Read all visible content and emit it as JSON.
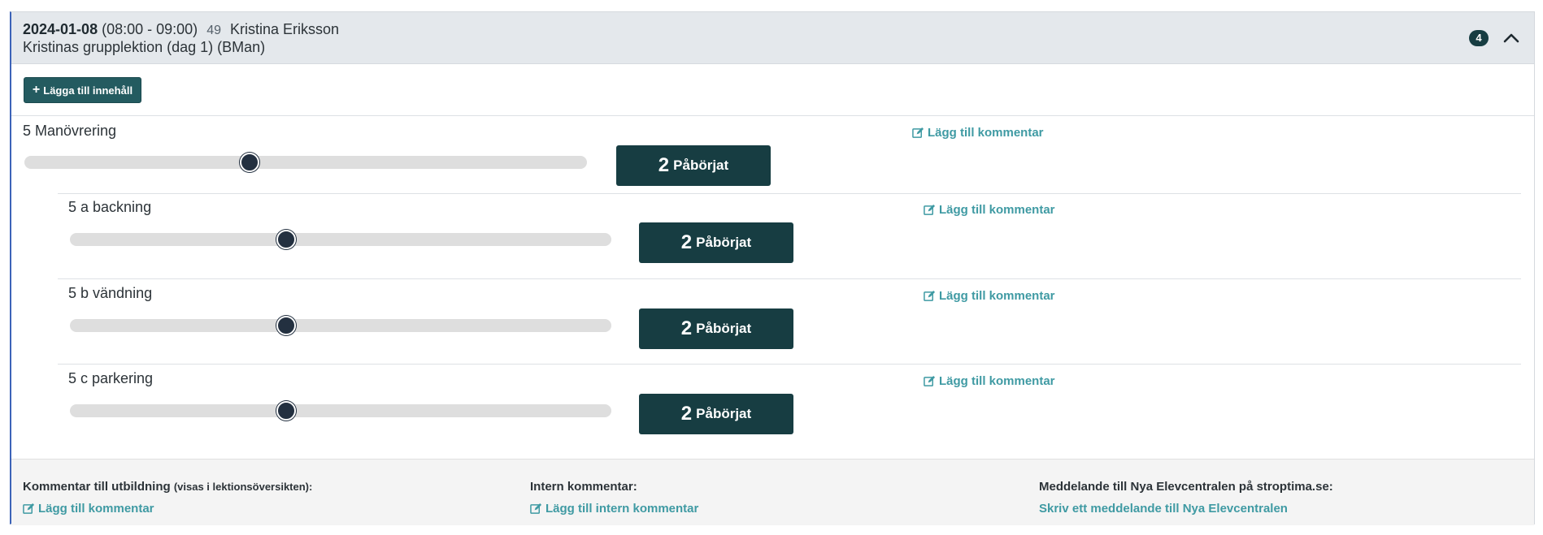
{
  "header": {
    "date": "2024-01-08",
    "time": "(08:00 - 09:00)",
    "number": "49",
    "student": "Kristina Eriksson",
    "lesson": "Kristinas grupplektion (dag 1) (BMan)",
    "badge_count": "4"
  },
  "toolbar": {
    "add_content_label": "Lägga till innehåll"
  },
  "items": [
    {
      "label": "5 Manövrering",
      "level": "2",
      "status": "Påbörjat",
      "progress": 0.4,
      "comment_label": "Lägg till kommentar"
    },
    {
      "label": "5 a backning",
      "level": "2",
      "status": "Påbörjat",
      "progress": 0.4,
      "comment_label": "Lägg till kommentar"
    },
    {
      "label": "5 b vändning",
      "level": "2",
      "status": "Påbörjat",
      "progress": 0.4,
      "comment_label": "Lägg till kommentar"
    },
    {
      "label": "5 c parkering",
      "level": "2",
      "status": "Påbörjat",
      "progress": 0.4,
      "comment_label": "Lägg till kommentar"
    }
  ],
  "footer": {
    "education_comment_title": "Kommentar till utbildning",
    "education_comment_note": "(visas i lektionsöversikten):",
    "education_comment_link": "Lägg till kommentar",
    "internal_comment_title": "Intern kommentar:",
    "internal_comment_link": "Lägg till intern kommentar",
    "message_title": "Meddelande till Nya Elevcentralen på stroptima.se:",
    "message_link": "Skriv ett meddelande till Nya Elevcentralen"
  },
  "colors": {
    "accent": "#173d42",
    "link": "#3f9aa3",
    "header_bg": "#e4e8ec"
  }
}
